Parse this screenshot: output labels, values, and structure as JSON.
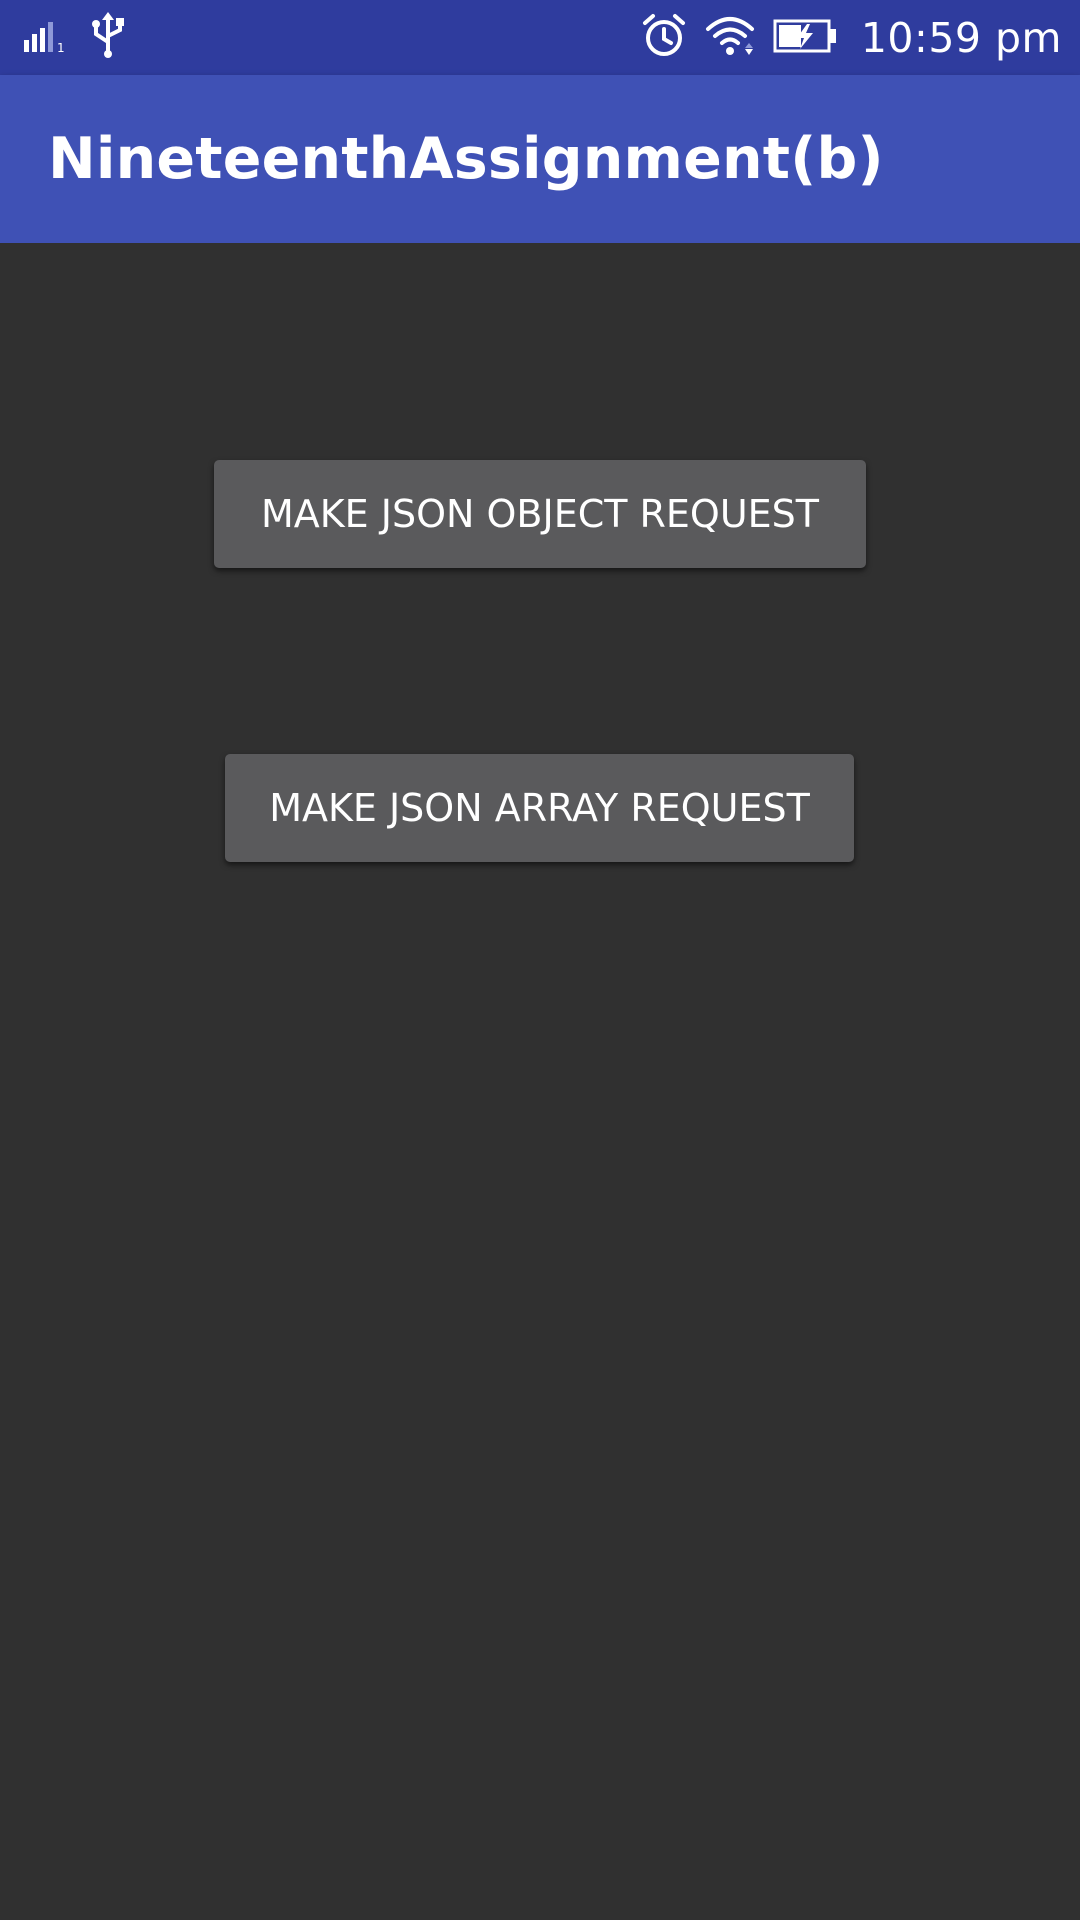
{
  "status_bar": {
    "time": "10:59 pm",
    "signal_sub": "1",
    "icons": [
      "signal-icon",
      "usb-icon",
      "alarm-icon",
      "wifi-icon",
      "battery-charging-icon"
    ],
    "background": "#2F3C9E"
  },
  "app_bar": {
    "title": "NineteenthAssignment(b)",
    "background": "#3F51B5"
  },
  "main": {
    "buttons": [
      {
        "label": "MAKE JSON OBJECT REQUEST"
      },
      {
        "label": "MAKE JSON ARRAY REQUEST"
      }
    ],
    "background": "#303030",
    "button_color": "#5A5A5C"
  }
}
